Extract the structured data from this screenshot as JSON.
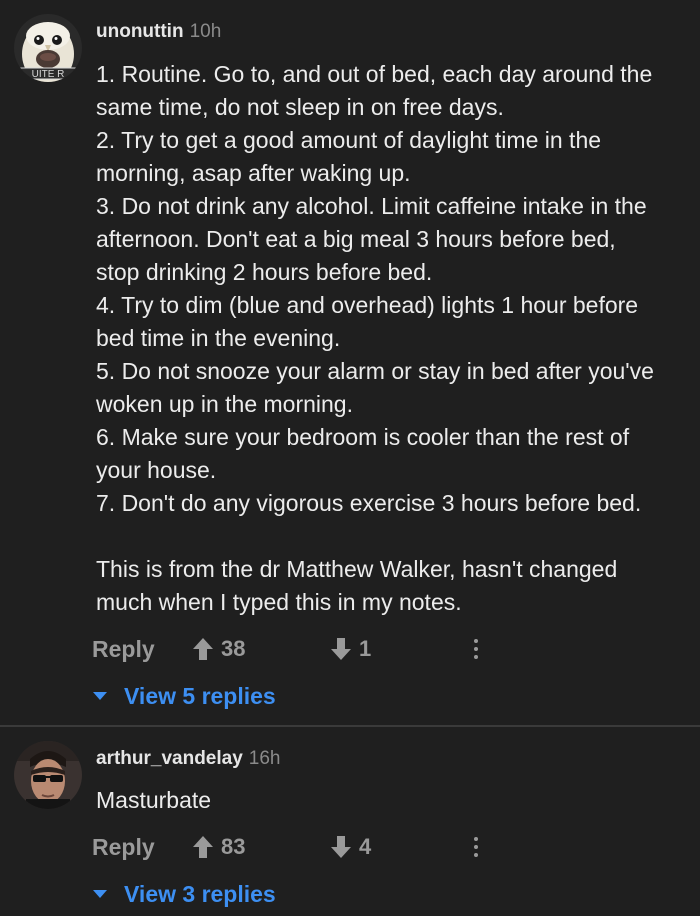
{
  "comments": [
    {
      "username": "unonuttin",
      "time": "10h",
      "avatar": {
        "icon": "owl-avatar",
        "badge_text": "UITE R"
      },
      "lines": [
        "1. Routine. Go to, and out of bed, each day around the",
        "same time, do not sleep in on free days.",
        "2. Try to get a good amount of daylight time in the",
        "morning, asap after waking up.",
        "3. Do not drink any alcohol. Limit caffeine intake in the",
        "afternoon. Don't eat a big meal 3 hours before bed,",
        "stop drinking 2 hours before bed.",
        "4. Try to dim (blue and overhead) lights 1 hour before",
        "bed time in the evening.",
        "5. Do not snooze your alarm or stay in bed after you've",
        "woken up in the morning.",
        "6. Make sure your bedroom is cooler than the rest of",
        "your house.",
        "7. Don't do any vigorous exercise 3 hours before bed.",
        "",
        "This is from the dr Matthew Walker, hasn't changed",
        "much when I typed this in my notes."
      ],
      "reply_label": "Reply",
      "upvotes": "38",
      "downvotes": "1",
      "view_replies": "View 5 replies"
    },
    {
      "username": "arthur_vandelay",
      "time": "16h",
      "avatar": {
        "icon": "sunglasses-man-avatar"
      },
      "lines": [
        "Masturbate"
      ],
      "reply_label": "Reply",
      "upvotes": "83",
      "downvotes": "4",
      "view_replies": "View 3 replies"
    }
  ],
  "colors": {
    "background": "#1f1f1f",
    "text": "#ececec",
    "muted": "#9a9a9a",
    "link": "#3d8ff2",
    "divider": "#3a3a3a"
  }
}
